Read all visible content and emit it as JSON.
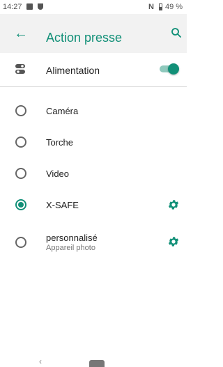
{
  "status_bar": {
    "time": "14:27",
    "nfc": "N",
    "battery": "49 %",
    "battery_level": 0.49
  },
  "app_bar": {
    "title": "Action presse"
  },
  "main_setting": {
    "label": "Alimentation",
    "enabled": true
  },
  "options": [
    {
      "label": "Caméra",
      "selected": false
    },
    {
      "label": "Torche",
      "selected": false
    },
    {
      "label": "Video",
      "selected": false
    },
    {
      "label": "X-SAFE",
      "selected": true,
      "has_settings": true
    },
    {
      "label": "personnalisé",
      "sublabel": "Appareil photo",
      "selected": false,
      "has_settings": true
    }
  ],
  "nav_bar": {
    "back_symbol": "‹"
  },
  "colors": {
    "accent": "#129078",
    "accent_light": "#8fc9bd",
    "appbar_bg": "#f2f2f2"
  },
  "icons": [
    "back-arrow-icon",
    "search-icon",
    "toggle-icon",
    "gear-icon",
    "home-icon"
  ]
}
